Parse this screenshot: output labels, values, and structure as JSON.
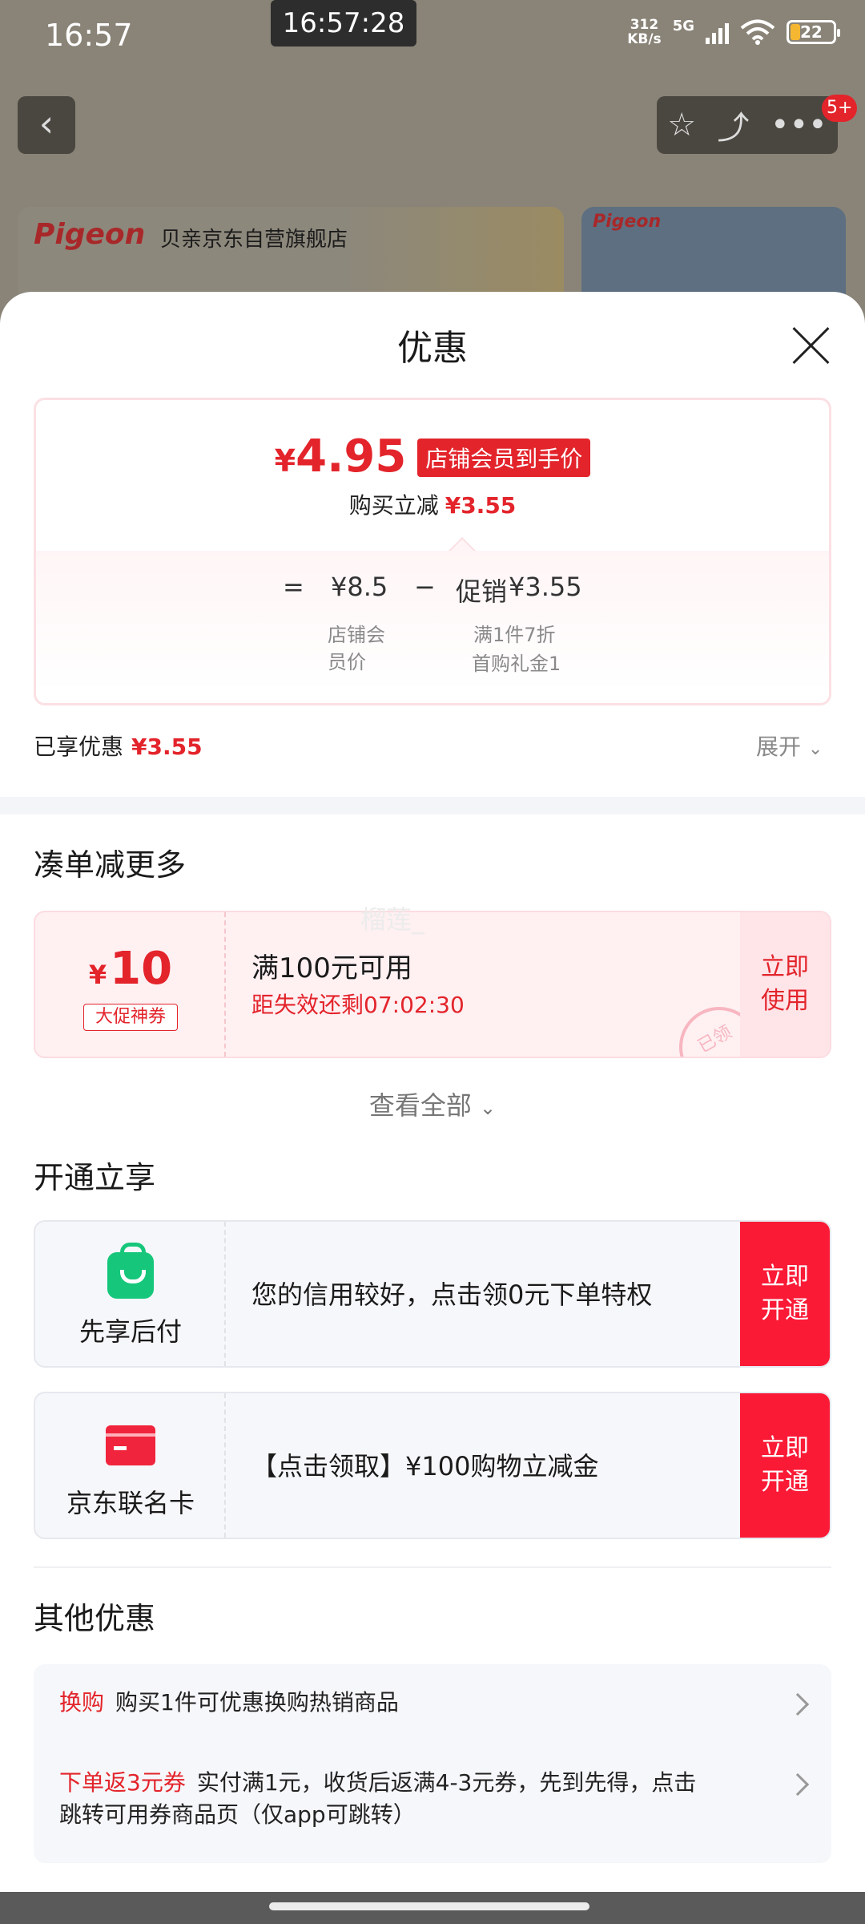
{
  "status_bar": {
    "time": "16:57",
    "clock_overlay": "16:57:28",
    "net_speed": "312",
    "net_unit": "KB/s",
    "signal": "5G",
    "battery": "22"
  },
  "background": {
    "back_icon": "chevron-left-icon",
    "badge": "5+",
    "store_logo": "Pigeon",
    "store_name": "贝亲京东自营旗舰店",
    "side_logo": "Pigeon"
  },
  "sheet": {
    "title": "优惠",
    "price_card": {
      "final_price_yen": "¥",
      "final_price": "4.95",
      "price_tag": "店铺会员到手价",
      "discount_label": "购买立减",
      "discount_value": "¥3.55",
      "equals": "=",
      "member_price": "¥8.5",
      "minus": "−",
      "promo_label": "促销",
      "promo_value": "¥3.55",
      "member_price_caption_1": "店铺会",
      "member_price_caption_2": "员价",
      "promo_caption_1": "满1件7折",
      "promo_caption_2": "首购礼金1"
    },
    "enjoyed_label": "已享优惠",
    "enjoyed_value": "¥3.55",
    "expand_label": "展开",
    "more_section_title": "凑单减更多",
    "coupon": {
      "yen": "¥",
      "amount": "10",
      "tag": "大促神券",
      "condition": "满100元可用",
      "timer": "距失效还剩07:02:30",
      "use_line1": "立即",
      "use_line2": "使用",
      "stamp": "已领",
      "watermark": "榴莲_"
    },
    "view_all_label": "查看全部",
    "open_section_title": "开通立享",
    "services": [
      {
        "icon": "shopping-bag-icon",
        "name": "先享后付",
        "desc": "您的信用较好，点击领0元下单特权",
        "btn_line1": "立即",
        "btn_line2": "开通"
      },
      {
        "icon": "credit-card-icon",
        "name": "京东联名卡",
        "desc": "【点击领取】¥100购物立减金",
        "btn_line1": "立即",
        "btn_line2": "开通"
      }
    ],
    "other_section_title": "其他优惠",
    "other_offers": [
      {
        "tag": "换购",
        "text": "购买1件可优惠换购热销商品"
      },
      {
        "tag": "下单返3元券",
        "text": "实付满1元，收货后返满4-3元券，先到先得，点击",
        "text2": "跳转可用券商品页（仅app可跳转）"
      }
    ]
  },
  "colors": {
    "accent_red": "#e3242b",
    "button_red": "#fa1a36",
    "green": "#16c77b"
  }
}
